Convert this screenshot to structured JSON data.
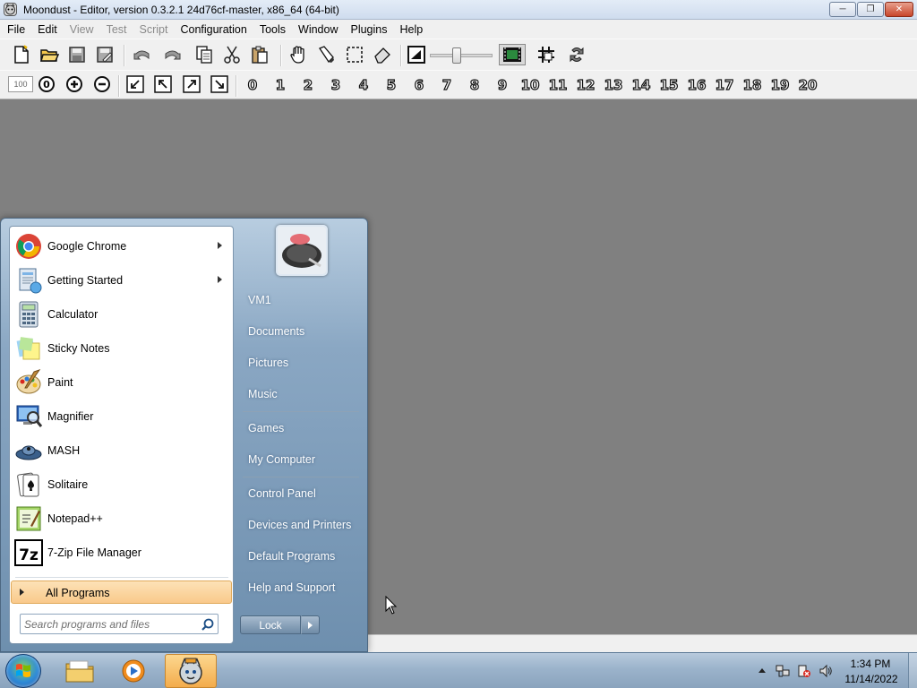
{
  "window": {
    "title": "Moondust - Editor, version 0.3.2.1 24d76cf-master, x86_64 (64-bit)"
  },
  "menu": [
    {
      "label": "File",
      "disabled": false
    },
    {
      "label": "Edit",
      "disabled": false
    },
    {
      "label": "View",
      "disabled": true
    },
    {
      "label": "Test",
      "disabled": true
    },
    {
      "label": "Script",
      "disabled": true
    },
    {
      "label": "Configuration",
      "disabled": false
    },
    {
      "label": "Tools",
      "disabled": false
    },
    {
      "label": "Window",
      "disabled": false
    },
    {
      "label": "Plugins",
      "disabled": false
    },
    {
      "label": "Help",
      "disabled": false
    }
  ],
  "toolbar": {
    "zoom_value": "100",
    "layers": [
      "0",
      "1",
      "2",
      "3",
      "4",
      "5",
      "6",
      "7",
      "8",
      "9",
      "10",
      "11",
      "12",
      "13",
      "14",
      "15",
      "16",
      "17",
      "18",
      "19",
      "20"
    ]
  },
  "start_menu": {
    "programs": [
      {
        "label": "Google Chrome",
        "icon": "chrome-icon",
        "has_submenu": true
      },
      {
        "label": "Getting Started",
        "icon": "getting-started-icon",
        "has_submenu": true
      },
      {
        "label": "Calculator",
        "icon": "calculator-icon",
        "has_submenu": false
      },
      {
        "label": "Sticky Notes",
        "icon": "sticky-notes-icon",
        "has_submenu": false
      },
      {
        "label": "Paint",
        "icon": "paint-icon",
        "has_submenu": false
      },
      {
        "label": "Magnifier",
        "icon": "magnifier-icon",
        "has_submenu": false
      },
      {
        "label": "MASH",
        "icon": "mash-icon",
        "has_submenu": false
      },
      {
        "label": "Solitaire",
        "icon": "solitaire-icon",
        "has_submenu": false
      },
      {
        "label": "Notepad++",
        "icon": "notepadpp-icon",
        "has_submenu": false
      },
      {
        "label": "7-Zip File Manager",
        "icon": "7zip-icon",
        "has_submenu": false
      }
    ],
    "all_programs": "All Programs",
    "search_placeholder": "Search programs and files",
    "right_items": [
      "VM1",
      "Documents",
      "Pictures",
      "Music",
      "Games",
      "My Computer",
      "Control Panel",
      "Devices and Printers",
      "Default Programs",
      "Help and Support"
    ],
    "lock_label": "Lock"
  },
  "taskbar": {
    "time": "1:34 PM",
    "date": "11/14/2022"
  }
}
